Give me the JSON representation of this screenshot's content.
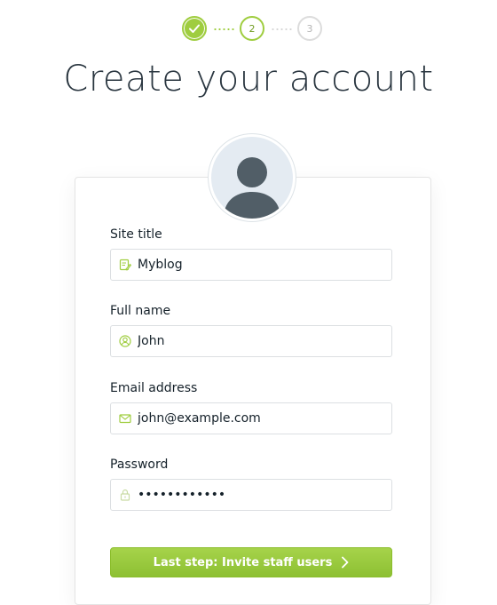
{
  "stepper": {
    "steps": [
      {
        "label": "",
        "state": "done",
        "icon": "check-icon"
      },
      {
        "label": "2",
        "state": "active"
      },
      {
        "label": "3",
        "state": "pending"
      }
    ]
  },
  "title": "Create your account",
  "avatar": {
    "icon": "user-silhouette-icon"
  },
  "form": {
    "site_title": {
      "label": "Site title",
      "value": "Myblog",
      "icon": "pen-paper-icon"
    },
    "full_name": {
      "label": "Full name",
      "value": "John",
      "icon": "user-circle-icon"
    },
    "email": {
      "label": "Email address",
      "value": "john@example.com",
      "icon": "envelope-icon"
    },
    "password": {
      "label": "Password",
      "value": "••••••••••••",
      "icon": "lock-icon"
    }
  },
  "submit": {
    "label": "Last step: Invite staff users",
    "icon": "chevron-right-icon"
  },
  "colors": {
    "accent": "#9fcd3f",
    "accent_dark": "#8dc033",
    "text": "#15212a",
    "border": "#dcdfe2"
  }
}
